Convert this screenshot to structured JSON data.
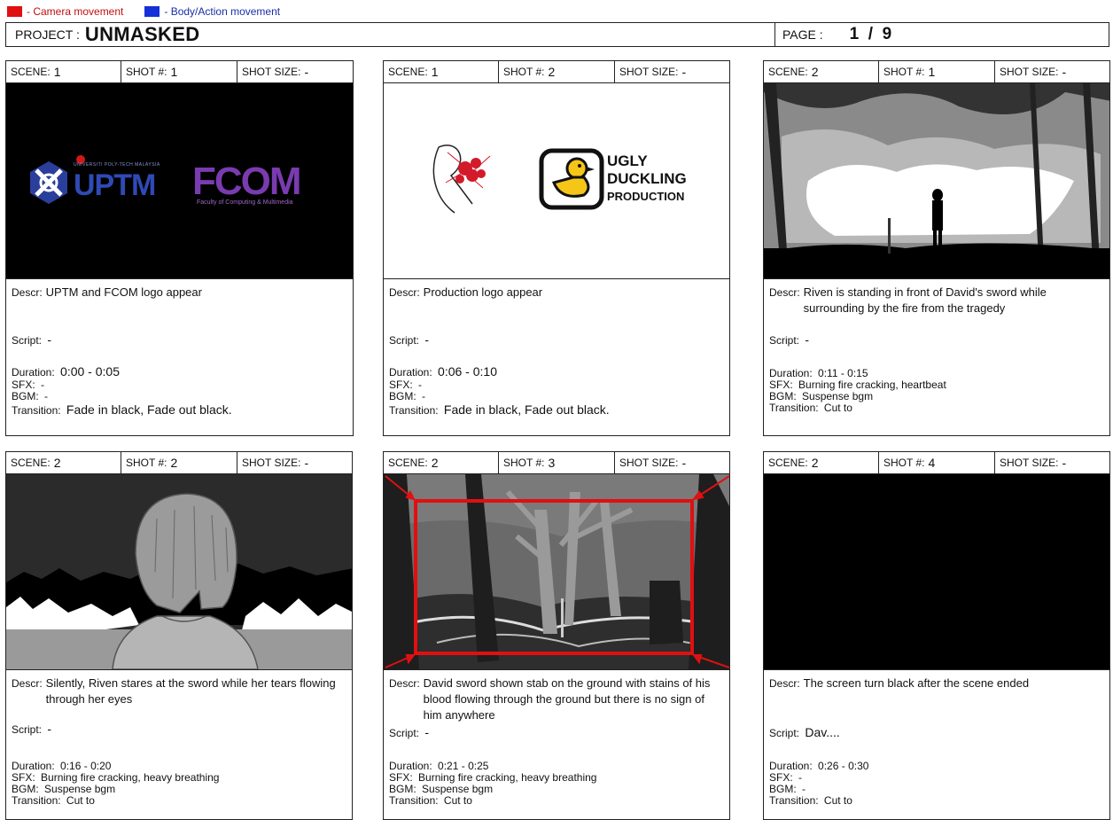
{
  "legend": {
    "camera": {
      "label": "- Camera movement",
      "color": "#e01010"
    },
    "body": {
      "label": "- Body/Action movement",
      "color": "#1530d8"
    }
  },
  "header": {
    "project_label": "PROJECT :",
    "project_name": "UNMASKED",
    "page_label": "PAGE :",
    "page_value": "1  /  9"
  },
  "labels": {
    "scene": "SCENE:",
    "shot": "SHOT #:",
    "shot_size": "SHOT SIZE:",
    "descr": "Descr:",
    "script": "Script:",
    "duration": "Duration:",
    "sfx": "SFX:",
    "bgm": "BGM:",
    "transition": "Transition:"
  },
  "panels": [
    {
      "scene": "1",
      "shot": "1",
      "shot_size": "-",
      "frame": "logos1",
      "descr": "UPTM and FCOM logo appear",
      "script": "-",
      "duration": "0:00 - 0:05",
      "sfx": "-",
      "bgm": "-",
      "transition": "Fade in black, Fade out black."
    },
    {
      "scene": "1",
      "shot": "2",
      "shot_size": "-",
      "frame": "logos2",
      "descr": "Production logo appear",
      "script": "-",
      "duration": "0:06 - 0:10",
      "sfx": "-",
      "bgm": "-",
      "transition": "Fade in black, Fade out black."
    },
    {
      "scene": "2",
      "shot": "1",
      "shot_size": "-",
      "frame": "fire",
      "descr": "Riven is standing in front of David's sword while surrounding by the fire from the tragedy",
      "script": "-",
      "duration": "0:11 - 0:15",
      "sfx": "Burning fire cracking, heartbeat",
      "bgm": "Suspense bgm",
      "transition": "Cut to"
    },
    {
      "scene": "2",
      "shot": "2",
      "shot_size": "-",
      "frame": "girl",
      "descr": "Silently, Riven stares at the sword while her tears flowing through her eyes",
      "script": "-",
      "duration": "0:16 - 0:20",
      "sfx": "Burning fire cracking, heavy breathing",
      "bgm": "Suspense bgm",
      "transition": "Cut to"
    },
    {
      "scene": "2",
      "shot": "3",
      "shot_size": "-",
      "frame": "forest",
      "descr": "David sword shown stab on the ground with stains of his blood flowing through the ground but there is no sign of him anywhere",
      "script": "-",
      "duration": "0:21 - 0:25",
      "sfx": "Burning fire cracking, heavy breathing",
      "bgm": "Suspense bgm",
      "transition": "Cut to"
    },
    {
      "scene": "2",
      "shot": "4",
      "shot_size": "-",
      "frame": "black",
      "descr": "The screen turn black after the scene ended",
      "script": "Dav....",
      "duration": "0:26 - 0:30",
      "sfx": "-",
      "bgm": "-",
      "transition": "Cut to"
    }
  ],
  "logos": {
    "uptm": "UPTM",
    "uptm_small": "UNIVERSITI POLY-TECH MALAYSIA",
    "fcom": "FCOM",
    "fcom_sub": "Faculty of Computing & Multimedia",
    "ugly1": "UGLY",
    "ugly2": "DUCKLING",
    "ugly3": "PRODUCTION"
  }
}
